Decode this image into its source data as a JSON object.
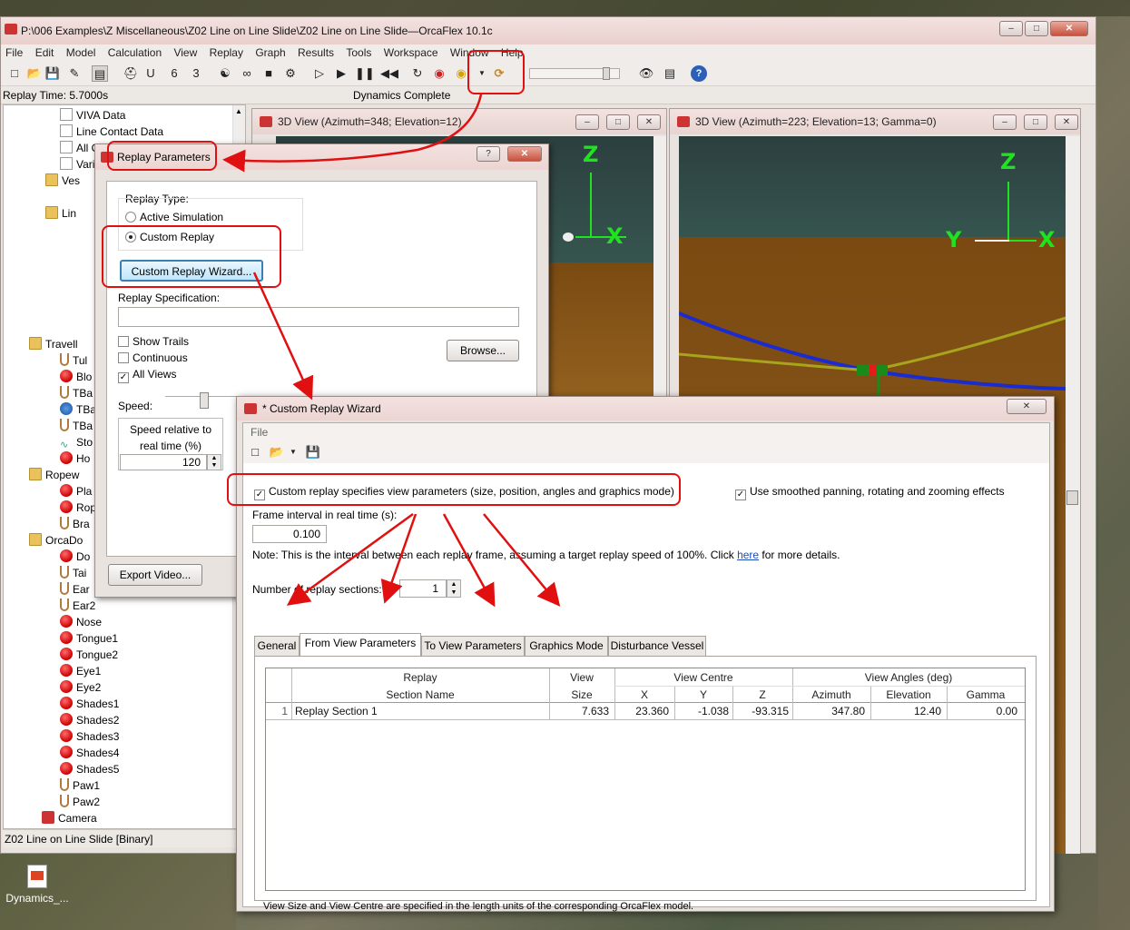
{
  "main": {
    "title": "P:\\006 Examples\\Z Miscellaneous\\Z02 Line on Line Slide\\Z02 Line on Line Slide—OrcaFlex 10.1c",
    "menu": [
      "File",
      "Edit",
      "Model",
      "Calculation",
      "View",
      "Replay",
      "Graph",
      "Results",
      "Tools",
      "Workspace",
      "Window",
      "Help"
    ],
    "replay_time": "Replay Time: 5.7000s",
    "status": "Dynamics Complete",
    "tree_status": "Z02 Line on Line Slide [Binary]",
    "tree_items": [
      "VIVA Data",
      "Line Contact Data",
      "All Ob",
      "Vari",
      "Ves",
      "Lin",
      "Travell",
      "Tul",
      "Blo",
      "TBa",
      "TBa",
      "TBa",
      "Sto",
      "Ho",
      "Ropew",
      "Pla",
      "Rop",
      "Bra",
      "OrcaDo",
      "Do",
      "Tai",
      "Ear",
      "Ear2",
      "Nose",
      "Tongue1",
      "Tongue2",
      "Eye1",
      "Eye2",
      "Shades1",
      "Shades2",
      "Shades3",
      "Shades4",
      "Shades5",
      "Paw1",
      "Paw2",
      "Camera"
    ]
  },
  "views": [
    {
      "title": "3D View (Azimuth=348; Elevation=12)",
      "axes": [
        "Z",
        "X"
      ]
    },
    {
      "title": "3D View (Azimuth=223; Elevation=13; Gamma=0)",
      "axes": [
        "Z",
        "Y",
        "X"
      ]
    }
  ],
  "replay_params": {
    "title": "Replay Parameters",
    "help_btn": "?",
    "replay_type_label": "Replay Type:",
    "option_active": "Active Simulation",
    "option_custom": "Custom Replay",
    "wizard_btn": "Custom Replay Wizard...",
    "spec_label": "Replay Specification:",
    "spec_value": "",
    "show_trails": "Show Trails",
    "continuous": "Continuous",
    "all_views": "All Views",
    "browse_btn": "Browse...",
    "speed_label": "Speed:",
    "speed_rel_label": "Speed relative to real time (%)",
    "speed_value": "120",
    "export_btn": "Export Video..."
  },
  "wizard": {
    "title": "* Custom Replay Wizard",
    "menu_file": "File",
    "custom_view_check": "Custom replay specifies view parameters (size, position, angles and graphics mode)",
    "smoothed_check": "Use smoothed panning, rotating and zooming effects",
    "frame_interval_label": "Frame interval in real time (s):",
    "frame_interval_value": "0.100",
    "note_prefix": "Note: This is the interval between each replay frame, assuming a target replay speed of 100%.  Click ",
    "note_link": "here",
    "note_suffix": " for more details.",
    "num_sections_label": "Number of replay sections:",
    "num_sections_value": "1",
    "tabs": [
      "General",
      "From View Parameters",
      "To View Parameters",
      "Graphics Mode",
      "Disturbance Vessel"
    ],
    "grid_headers": {
      "replay": "Replay",
      "section_name": "Section Name",
      "view": "View",
      "size": "Size",
      "view_centre": "View Centre",
      "x": "X",
      "y": "Y",
      "z": "Z",
      "view_angles": "View Angles (deg)",
      "azimuth": "Azimuth",
      "elevation": "Elevation",
      "gamma": "Gamma"
    },
    "rows": [
      {
        "index": "1",
        "name": "Replay Section 1",
        "size": "7.633",
        "x": "23.360",
        "y": "-1.038",
        "z": "-93.315",
        "azimuth": "347.80",
        "elevation": "12.40",
        "gamma": "0.00"
      }
    ],
    "footer_note": "View Size and View Centre are specified in the length units of the corresponding OrcaFlex model."
  },
  "desktop_icon_label": "Dynamics_...",
  "colors": {
    "annotation_red": "#e01010",
    "axis_green": "#1ee31e",
    "line_blue": "#1a2bd0",
    "line_yellow": "#a8a41c"
  }
}
